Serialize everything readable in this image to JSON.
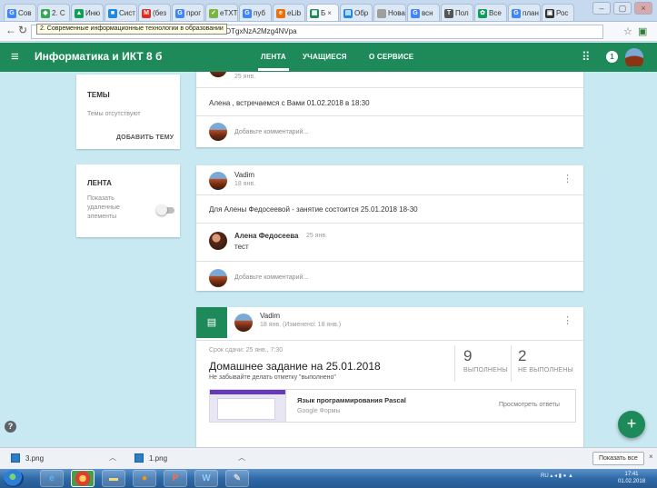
{
  "browser": {
    "tabs": [
      {
        "label": "Сов",
        "color": "#4285f4",
        "glyph": "G"
      },
      {
        "label": "2. С",
        "color": "#34a853",
        "glyph": "◆"
      },
      {
        "label": "Иню",
        "color": "#0f9d58",
        "glyph": "▲"
      },
      {
        "label": "Сист",
        "color": "#1e88e5",
        "glyph": "■"
      },
      {
        "label": "(без",
        "color": "#d93025",
        "glyph": "M"
      },
      {
        "label": "прог",
        "color": "#4285f4",
        "glyph": "G"
      },
      {
        "label": "eTXT",
        "color": "#7cb342",
        "glyph": "✓"
      },
      {
        "label": "пуб",
        "color": "#4285f4",
        "glyph": "G"
      },
      {
        "label": "eLib",
        "color": "#e8710a",
        "glyph": "e"
      },
      {
        "label": "Б",
        "color": "#1e8a5a",
        "glyph": "▦",
        "close": "×"
      },
      {
        "label": "Обр",
        "color": "#1e88e5",
        "glyph": "▤"
      },
      {
        "label": "Новая",
        "color": "#9e9e9e",
        "glyph": ""
      },
      {
        "label": "всн",
        "color": "#4285f4",
        "glyph": "G"
      },
      {
        "label": "Пол",
        "color": "#555555",
        "glyph": "T"
      },
      {
        "label": "Все",
        "color": "#0f9d58",
        "glyph": "✿"
      },
      {
        "label": "план",
        "color": "#4285f4",
        "glyph": "G"
      },
      {
        "label": "Рос",
        "color": "#333333",
        "glyph": "▣"
      }
    ],
    "url_suffix": "0/c/OTgxNzA2Mzg4NVpa",
    "url_tooltip": "2. Современные информационные технологии в образовании"
  },
  "app": {
    "class_title": "Информатика и ИКТ 8 б",
    "tabs": [
      "ЛЕНТА",
      "УЧАЩИЕСЯ",
      "О СЕРВИСЕ"
    ],
    "notification_count": "1"
  },
  "sidebar": {
    "topics": {
      "title": "ТЕМЫ",
      "empty_text": "Темы отсутствуют",
      "add_label": "ДОБАВИТЬ ТЕМУ"
    },
    "stream": {
      "title": "ЛЕНТА",
      "toggle_label": "Показать удаленные элементы",
      "toggle_on": false
    }
  },
  "posts": [
    {
      "date": "25 янв.",
      "text": "Алена , встречаемся с Вами 01.02.2018 в 18:30",
      "comment_placeholder": "Добавьте комментарий..."
    },
    {
      "author": "Vadim",
      "date": "18 янв.",
      "text": "Для Алены Федосеевой - занятие состоится 25.01.2018 18-30",
      "comment": {
        "author": "Алена Федосеева",
        "date": "25 янв.",
        "text": "тест"
      },
      "comment_placeholder": "Добавьте комментарий..."
    }
  ],
  "assignment": {
    "author": "Vadim",
    "date": "18 янв. (Изменено: 18 янв.)",
    "due": "Срок сдачи: 25 янв., 7:30",
    "title": "Домашнее задание на 25.01.2018",
    "note": "Не забывайте делать отметку \"выполнено\"",
    "done_count": "9",
    "done_label": "ВЫПОЛНЕНЫ",
    "notdone_count": "2",
    "notdone_label": "НЕ ВЫПОЛНЕНЫ",
    "attachment_title": "Язык программирования Pascal",
    "attachment_type": "Google Формы",
    "view_answers": "Просмотреть ответы"
  },
  "downloads": {
    "items": [
      "3.png",
      "1.png"
    ],
    "show_all": "Показать все"
  },
  "taskbar": {
    "tray_text": "RU",
    "time": "17:41",
    "date": "01.02.2018"
  },
  "colors": {
    "brand": "#1e8a5a",
    "background": "#c9e9f2"
  }
}
